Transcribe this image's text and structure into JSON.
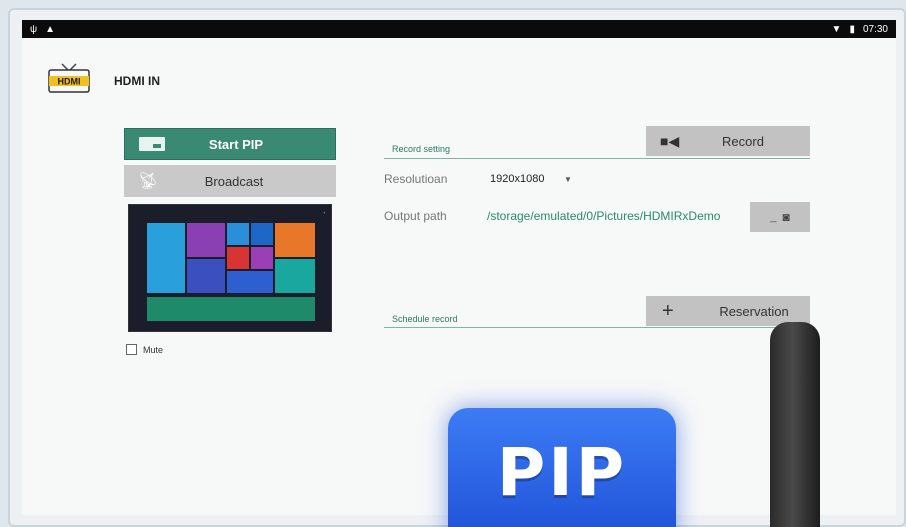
{
  "status_bar": {
    "time": "07:30",
    "left_icons": [
      "usb-icon",
      "warning-icon"
    ],
    "right_icons": [
      "wifi-icon",
      "battery-icon"
    ]
  },
  "app": {
    "title": "HDMI IN",
    "logo_text": "HDMI"
  },
  "left_panel": {
    "start_pip_label": "Start PIP",
    "broadcast_label": "Broadcast",
    "mute_label": "Mute",
    "mute_checked": false
  },
  "record": {
    "section_label": "Record setting",
    "record_button": "Record",
    "resolution_label": "Resolutioan",
    "resolution_value": "1920x1080",
    "output_label": "Output path",
    "output_value": "/storage/emulated/0/Pictures/HDMIRxDemo",
    "output_button_prefix": "_"
  },
  "schedule": {
    "section_label": "Schedule record",
    "reservation_button": "Reservation"
  },
  "overlay": {
    "badge_text": "PIP"
  },
  "colors": {
    "accent": "#3a8a73",
    "badge": "#2a5fe8"
  }
}
